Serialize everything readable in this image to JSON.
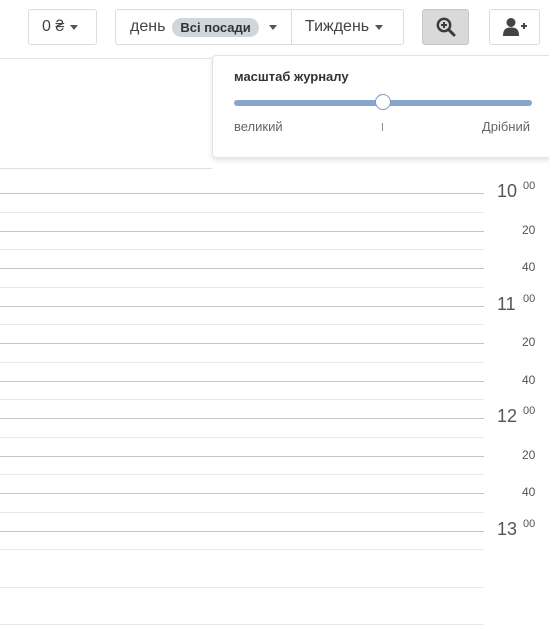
{
  "toolbar": {
    "currency_label": "0 ₴",
    "day_label": "день",
    "positions_badge": "Всі посади",
    "week_label": "Тиждень",
    "zoom_icon": "zoom-in-icon",
    "add_user_icon": "add-user-icon"
  },
  "zoom_popover": {
    "title": "масштаб журналу",
    "min_label": "великий",
    "max_label": "Дрібний",
    "slider_value": 0.5
  },
  "timeline": {
    "hours": [
      {
        "hour": "10",
        "sup": "00",
        "minutes": [
          "20",
          "40"
        ]
      },
      {
        "hour": "11",
        "sup": "00",
        "minutes": [
          "20",
          "40"
        ]
      },
      {
        "hour": "12",
        "sup": "00",
        "minutes": [
          "20",
          "40"
        ]
      },
      {
        "hour": "13",
        "sup": "00",
        "minutes": []
      }
    ]
  },
  "colors": {
    "slider_track": "#86a5ce",
    "zoom_button_bg": "#d9d9d9"
  }
}
